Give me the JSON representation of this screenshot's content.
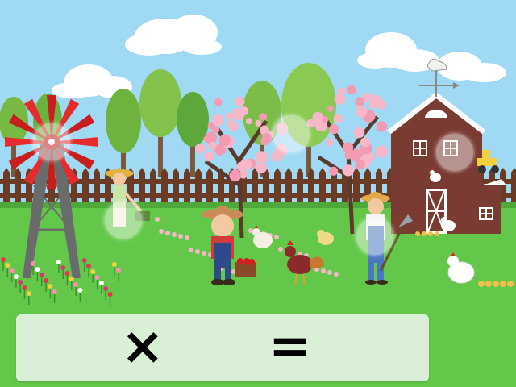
{
  "game": {
    "operator_symbol": "×",
    "equals_symbol": "=",
    "hint_spots": 6
  },
  "colors": {
    "sky": "#9fd9f4",
    "grass": "#63c84a",
    "grass_dark": "#4fa83a",
    "fence": "#6b3b26",
    "barn": "#7a3b32",
    "barn_trim": "#ffffff",
    "windmill_blades": "#e52b2b",
    "blossom": "#f7b7c8",
    "panel": "#d9efd6"
  },
  "icons": [
    "windmill-icon",
    "barn-icon",
    "weathervane-icon",
    "tractor-icon",
    "rooster-icon",
    "hen-icon",
    "chick-icon",
    "farmer-boy-icon",
    "farmer-woman-icon",
    "farmer-man-icon",
    "cherry-blossom-tree-icon"
  ]
}
